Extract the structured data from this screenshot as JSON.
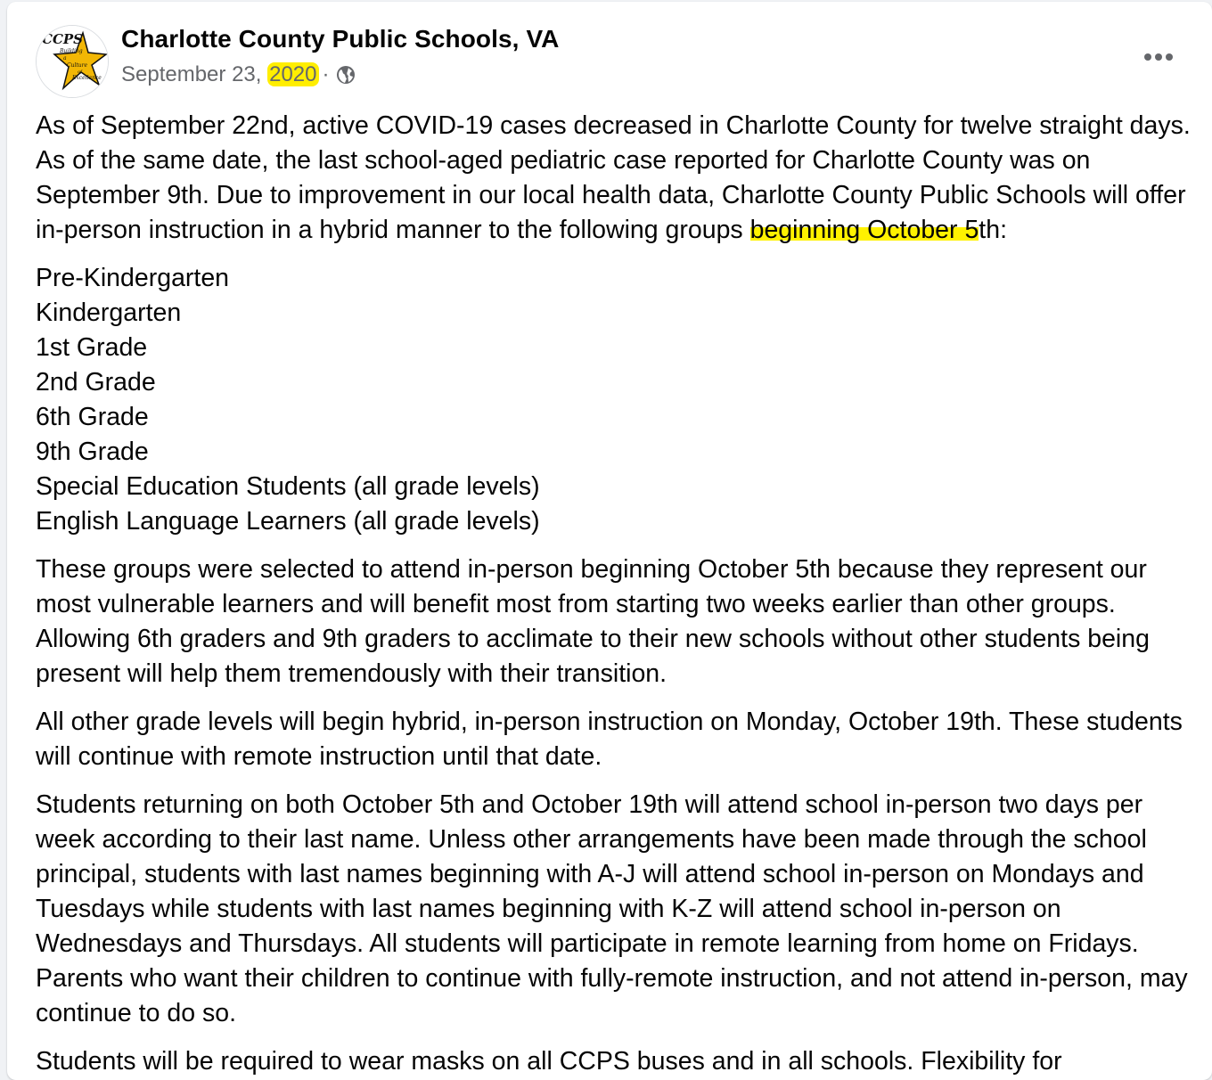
{
  "post": {
    "page_name": "Charlotte County Public Schools, VA",
    "date_prefix": "September 23, ",
    "date_year": "2020",
    "privacy_icon": "globe-icon",
    "more_icon": "more-options-icon",
    "avatar_logo_text": "CCPS",
    "avatar_tagline": [
      "Building",
      "Culture",
      "of",
      "Excellence"
    ]
  },
  "paragraphs": {
    "p1_main": "As of September 22nd, active COVID-19 cases decreased in Charlotte County for twelve straight days. As of the same date, the last school-aged pediatric case reported for Charlotte County was on September 9th. Due to improvement in our local health data, Charlotte County Public Schools will offer in-person instruction in a hybrid manner to the following groups ",
    "p1_highlight": "beginning October 5",
    "p1_end": "th:",
    "groups": [
      "Pre-Kindergarten",
      "Kindergarten",
      "1st Grade",
      "2nd Grade",
      "6th Grade",
      "9th Grade",
      "Special Education Students (all grade levels)",
      "English Language Learners (all grade levels)"
    ],
    "p2": "These groups were selected to attend in-person beginning October 5th because they represent our most vulnerable learners and will benefit most from starting two weeks earlier than other groups. Allowing 6th graders and 9th graders to acclimate to their new schools without other students being present will help them tremendously with their transition.",
    "p3": "All other grade levels will begin hybrid, in-person instruction on Monday, October 19th. These students will continue with remote instruction until that date.",
    "p4": "Students returning on both October 5th and October 19th will attend school in-person two days per week according to their last name. Unless other arrangements have been made through the school principal, students with last names beginning with A-J will attend school in-person on Mondays and Tuesdays while students with last names beginning with K-Z will attend school in-person on Wednesdays and Thursdays. All students will participate in remote learning from home on Fridays. Parents who want their children to continue with fully-remote instruction, and not attend in-person, may continue to do so.",
    "p5": "Students will be required to wear masks on all CCPS buses and in all schools. Flexibility for"
  },
  "colors": {
    "highlight": "#fff200",
    "meta_text": "#65676b",
    "logo_star": "#f2b705"
  }
}
